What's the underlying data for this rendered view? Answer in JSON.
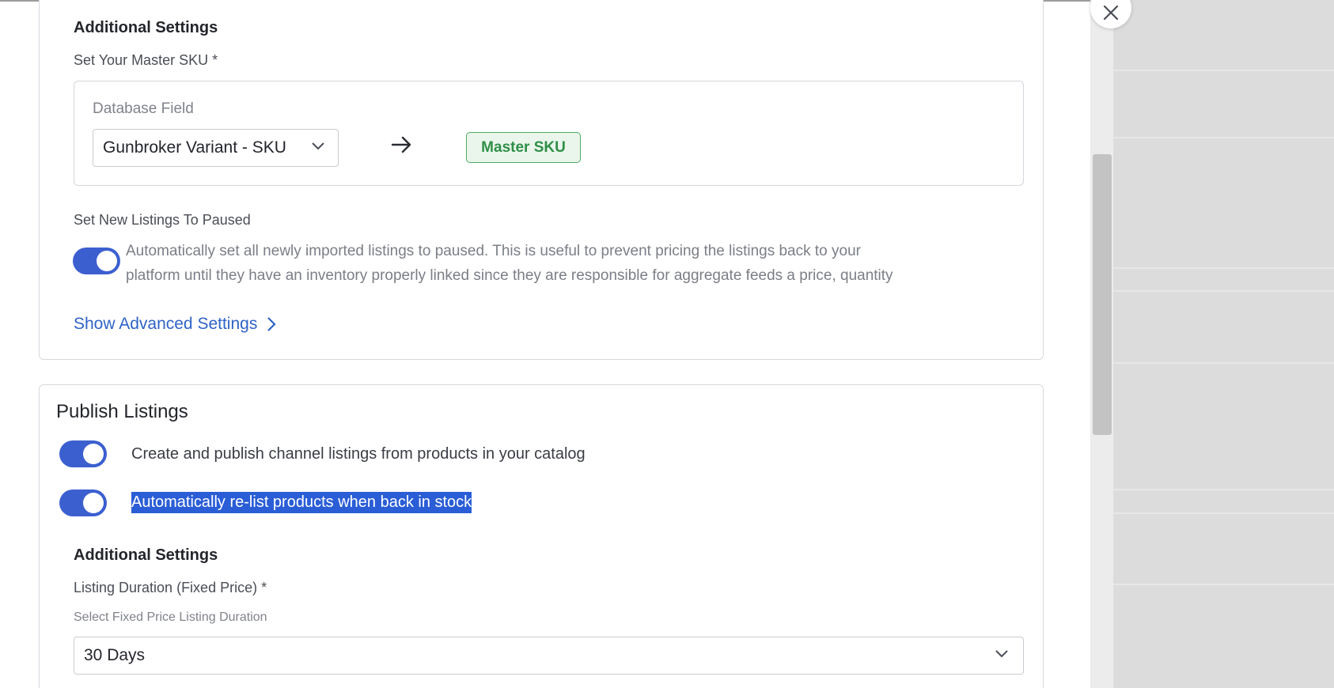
{
  "additional_settings_1": {
    "heading": "Additional Settings",
    "master_sku_label": "Set Your Master SKU *",
    "database_field_label": "Database Field",
    "database_field_value": "Gunbroker Variant - SKU",
    "master_sku_badge": "Master SKU",
    "paused_label": "Set New Listings To Paused",
    "paused_description_line1": "Automatically set all newly imported listings to paused. This is useful to prevent pricing the listings back to your",
    "paused_description_line2": "platform until they have an inventory properly linked since they are responsible for aggregate feeds a price, quantity",
    "show_advanced_link": "Show Advanced Settings"
  },
  "publish_listings": {
    "title": "Publish Listings",
    "toggle_create_label": "Create and publish channel listings from products in your catalog",
    "toggle_relist_label": "Automatically re-list products when back in stock",
    "additional_heading": "Additional Settings",
    "duration_label": "Listing Duration (Fixed Price) *",
    "duration_hint": "Select Fixed Price Listing Duration",
    "duration_value": "30 Days"
  },
  "colors": {
    "toggle_on": "#3c5fd0",
    "link": "#2f63c6",
    "badge_green": "#2f8f47",
    "selection_highlight": "#2a5dd6"
  }
}
